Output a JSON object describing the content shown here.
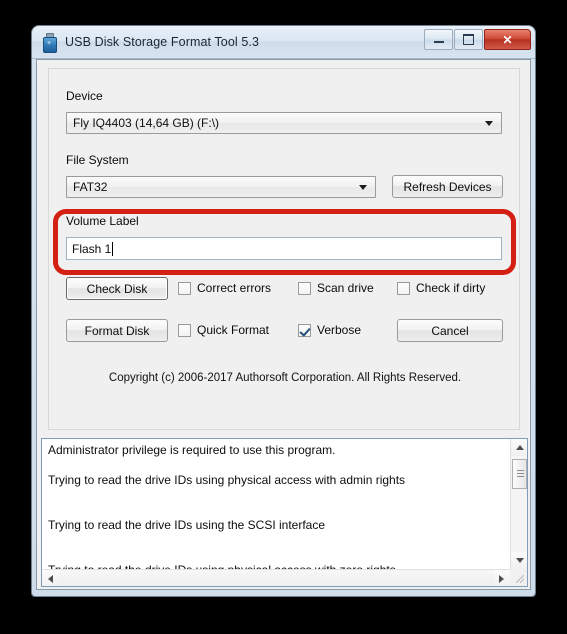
{
  "window": {
    "title": "USB Disk Storage Format Tool 5.3",
    "icon": "usb-drive-icon",
    "minimize_label": "Minimize",
    "maximize_label": "Maximize",
    "close_label": "✕"
  },
  "form": {
    "device": {
      "label": "Device",
      "value": "Fly  IQ4403   (14,64 GB) (F:\\)"
    },
    "file_system": {
      "label": "File System",
      "value": "FAT32"
    },
    "refresh_button": "Refresh Devices",
    "volume_label": {
      "label": "Volume Label",
      "value": "Flash 1"
    },
    "check_disk_button": "Check Disk",
    "format_disk_button": "Format Disk",
    "cancel_button": "Cancel",
    "checkboxes": [
      {
        "label": "Correct errors",
        "checked": false
      },
      {
        "label": "Scan drive",
        "checked": false
      },
      {
        "label": "Check if dirty",
        "checked": false
      },
      {
        "label": "Quick Format",
        "checked": false
      },
      {
        "label": "Verbose",
        "checked": true
      }
    ],
    "copyright": "Copyright (c) 2006-2017 Authorsoft Corporation. All Rights Reserved."
  },
  "log": {
    "lines": [
      "Administrator privilege is required to use this program.",
      "",
      "Trying to read the drive IDs using physical access with admin rights",
      "",
      "",
      "Trying to read the drive IDs using the SCSI interface",
      "",
      "",
      "Trying to read the drive IDs using physical access with zero rights"
    ]
  },
  "annotation": {
    "highlight_color": "#d41f13",
    "target": "volume-label-group"
  }
}
